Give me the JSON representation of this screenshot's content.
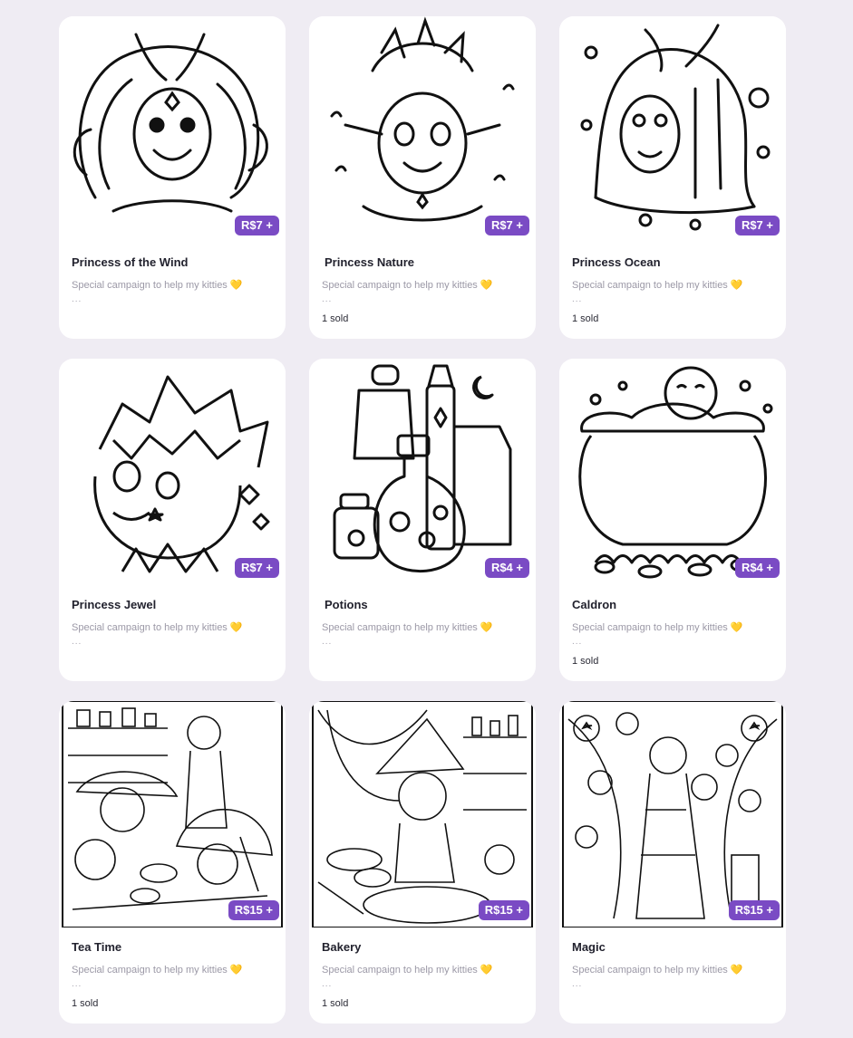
{
  "products": [
    {
      "title": "Princess of the Wind",
      "price": "R$7 +",
      "description": "Special campaign to help my kitties",
      "more": "...",
      "sold": "",
      "image": "princess-wind-line-art"
    },
    {
      "title": "Princess Nature",
      "price": "R$7 +",
      "description": "Special campaign to help my kitties",
      "more": "...",
      "sold": "1 sold",
      "image": "princess-nature-line-art"
    },
    {
      "title": "Princess Ocean",
      "price": "R$7 +",
      "description": "Special campaign to help my kitties",
      "more": "...",
      "sold": "1 sold",
      "image": "princess-ocean-line-art"
    },
    {
      "title": "Princess Jewel",
      "price": "R$7 +",
      "description": "Special campaign to help my kitties",
      "more": "...",
      "sold": "",
      "image": "princess-jewel-line-art"
    },
    {
      "title": "Potions",
      "price": "R$4 +",
      "description": "Special campaign to help my kitties",
      "more": "...",
      "sold": "",
      "image": "potions-line-art"
    },
    {
      "title": "Caldron",
      "price": "R$4 +",
      "description": "Special campaign to help my kitties",
      "more": "...",
      "sold": "1 sold",
      "image": "caldron-line-art"
    },
    {
      "title": "Tea Time",
      "price": "R$15 +",
      "description": "Special campaign to help my kitties",
      "more": "...",
      "sold": "1 sold",
      "image": "tea-time-line-art"
    },
    {
      "title": "Bakery",
      "price": "R$15 +",
      "description": "Special campaign to help my kitties",
      "more": "...",
      "sold": "1 sold",
      "image": "bakery-line-art"
    },
    {
      "title": "Magic",
      "price": "R$15 +",
      "description": "Special campaign to help my kitties",
      "more": "...",
      "sold": "",
      "image": "magic-line-art"
    }
  ],
  "description_emoji": "💛",
  "colors": {
    "background": "#efecf3",
    "card": "#ffffff",
    "price_badge": "#7a4bc4",
    "muted_text": "#9b98a6"
  }
}
